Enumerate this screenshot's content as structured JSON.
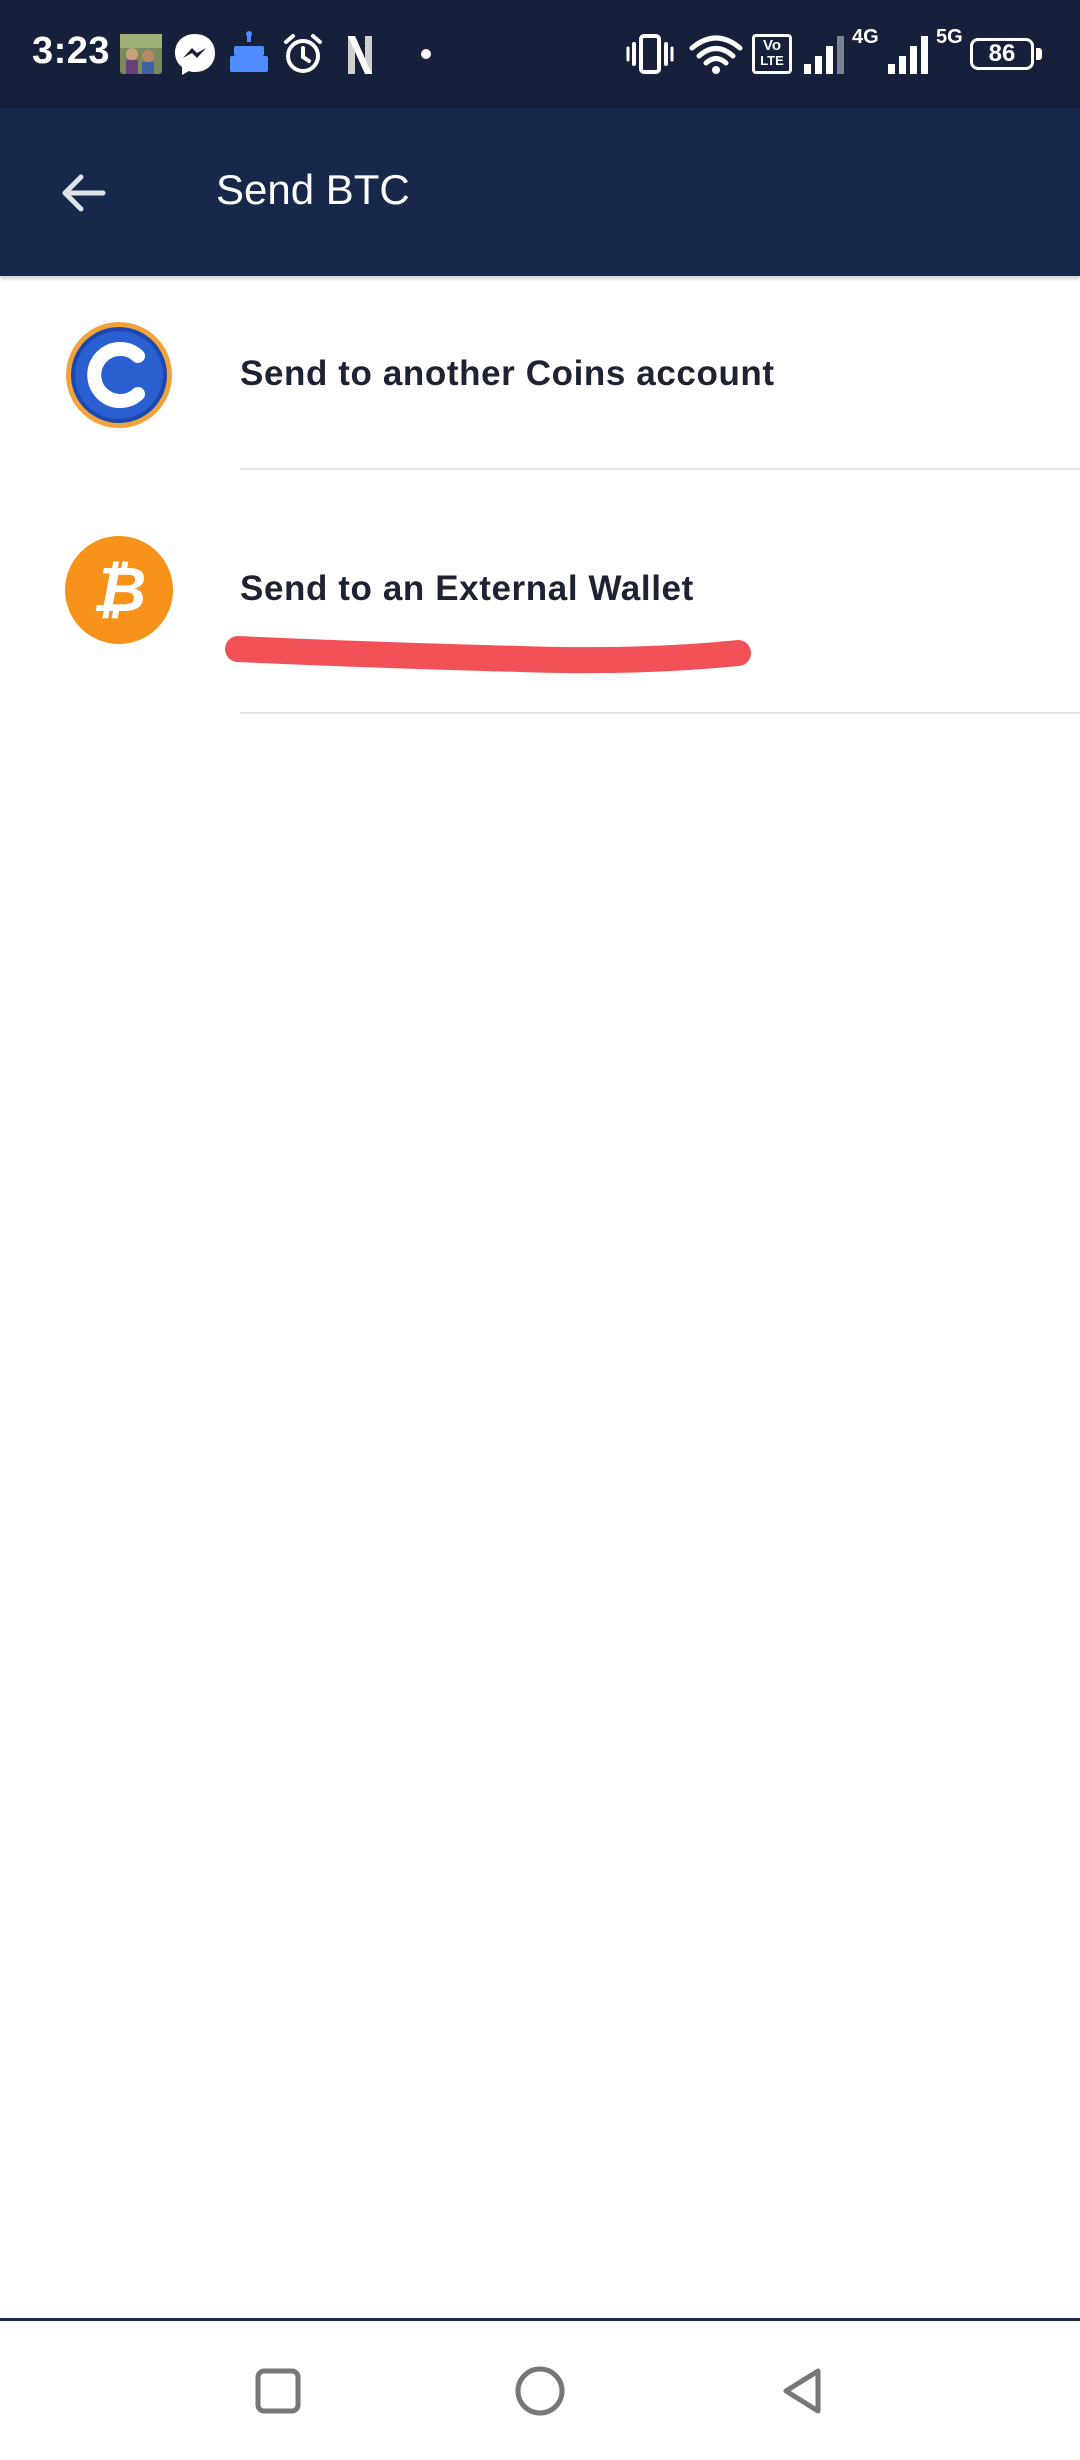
{
  "status_bar": {
    "time": "3:23",
    "battery": "86",
    "network_1": "4G",
    "network_2": "5G",
    "volte_top": "Vo",
    "volte_bottom": "LTE",
    "notification_letter": "N"
  },
  "app_bar": {
    "title": "Send BTC"
  },
  "options": [
    {
      "label": "Send to another Coins account",
      "icon": "coins-logo-icon",
      "icon_letter": "C"
    },
    {
      "label": "Send to an External Wallet",
      "icon": "bitcoin-icon",
      "icon_letter": "₿"
    }
  ],
  "colors": {
    "status_bar_bg": "#16203b",
    "app_bar_bg": "#17284a",
    "coins_blue": "#1d4fbd",
    "coins_ring": "#f2a33a",
    "bitcoin_orange": "#f7931a",
    "annotation_red": "#f25257"
  }
}
